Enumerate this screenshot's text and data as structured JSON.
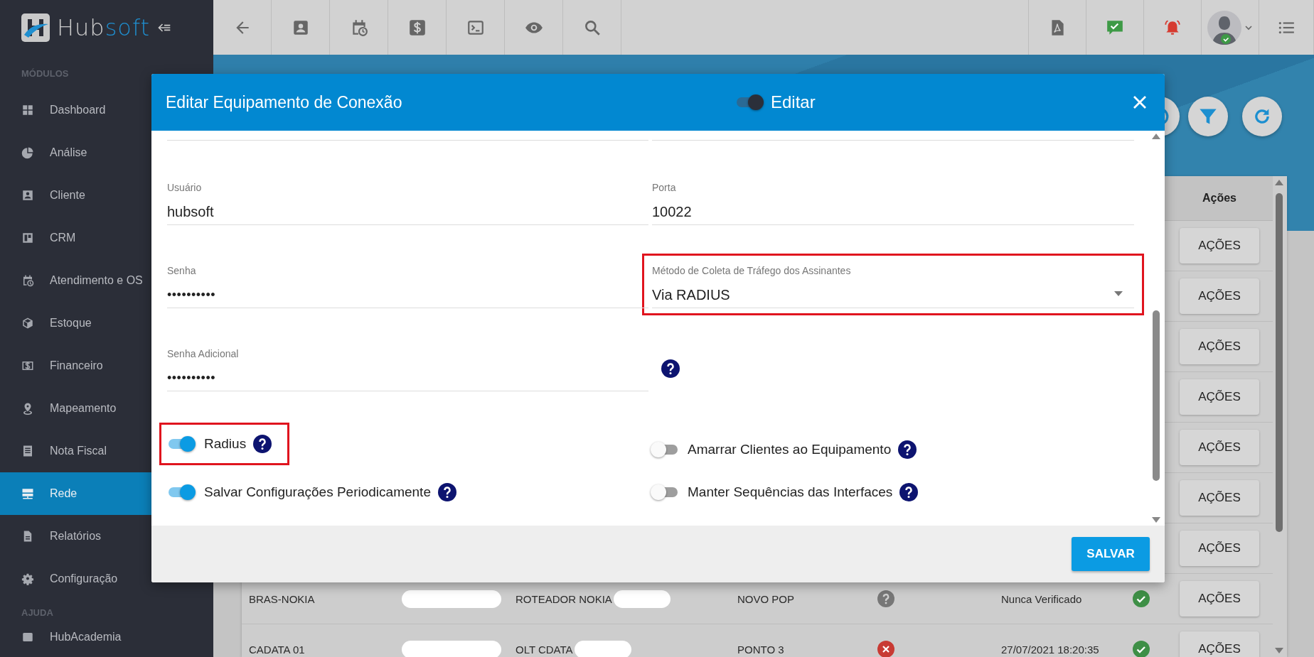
{
  "header": {
    "logo": {
      "part_1": "Hub",
      "part_2": "soft"
    }
  },
  "sidebar": {
    "sections": [
      {
        "heading": "MÓDULOS",
        "items": [
          {
            "label": "Dashboard",
            "selected": false
          },
          {
            "label": "Análise",
            "selected": false
          },
          {
            "label": "Cliente",
            "selected": false
          },
          {
            "label": "CRM",
            "selected": false
          },
          {
            "label": "Atendimento e OS",
            "selected": false
          },
          {
            "label": "Estoque",
            "selected": false
          },
          {
            "label": "Financeiro",
            "selected": false
          },
          {
            "label": "Mapeamento",
            "selected": false
          },
          {
            "label": "Nota Fiscal",
            "selected": false
          },
          {
            "label": "Rede",
            "selected": true
          },
          {
            "label": "Relatórios",
            "selected": false
          },
          {
            "label": "Configuração",
            "selected": false
          }
        ]
      },
      {
        "heading": "AJUDA",
        "items": [
          {
            "label": "HubAcademia",
            "selected": false
          }
        ]
      }
    ]
  },
  "table": {
    "columns": [
      {
        "label": "Ações"
      }
    ],
    "rows": [
      {
        "action": "AÇÕES"
      },
      {
        "action": "AÇÕES"
      },
      {
        "action": "AÇÕES"
      },
      {
        "action": "AÇÕES"
      },
      {
        "action": "AÇÕES"
      },
      {
        "action": "AÇÕES"
      },
      {
        "action": "AÇÕES"
      },
      {
        "name": "BRAS-NOKIA",
        "type": "ROTEADOR NOKIA",
        "pop": "NOVO POP",
        "status_icon": {
          "kind": "unknown"
        },
        "last_check": "Nunca Verificado",
        "online": true,
        "action": "AÇÕES"
      },
      {
        "name": "CADATA 01",
        "type": "OLT CDATA",
        "pop": "PONTO 3",
        "status_icon": {
          "kind": "error"
        },
        "last_check": "27/07/2021 18:20:35",
        "online": true,
        "action": "AÇÕES"
      }
    ]
  },
  "modal": {
    "title": "Editar Equipamento de Conexão",
    "edit_toggle": {
      "label": "Editar",
      "on": true
    },
    "fields": [
      {
        "kind": "text",
        "label": "Usuário",
        "value": "hubsoft",
        "highlighted": false
      },
      {
        "kind": "text",
        "label": "Porta",
        "value": "10022",
        "highlighted": false
      },
      {
        "kind": "password",
        "label": "Senha",
        "value": "••••••••••",
        "highlighted": false
      },
      {
        "kind": "select",
        "label": "Método de Coleta de Tráfego dos Assinantes",
        "value": "Via RADIUS",
        "highlighted": true
      },
      {
        "kind": "password",
        "label": "Senha Adicional",
        "value": "••••••••••",
        "highlighted": false
      },
      {
        "kind": "help",
        "highlighted": false
      }
    ],
    "switches": [
      {
        "label": "Radius",
        "on": true,
        "highlighted": true
      },
      {
        "label": "Amarrar Clientes ao Equipamento",
        "on": false,
        "highlighted": false
      },
      {
        "label": "Salvar Configurações Periodicamente",
        "on": true,
        "highlighted": false
      },
      {
        "label": "Manter Sequências das Interfaces",
        "on": false,
        "highlighted": false
      }
    ],
    "save_button": "SALVAR"
  }
}
